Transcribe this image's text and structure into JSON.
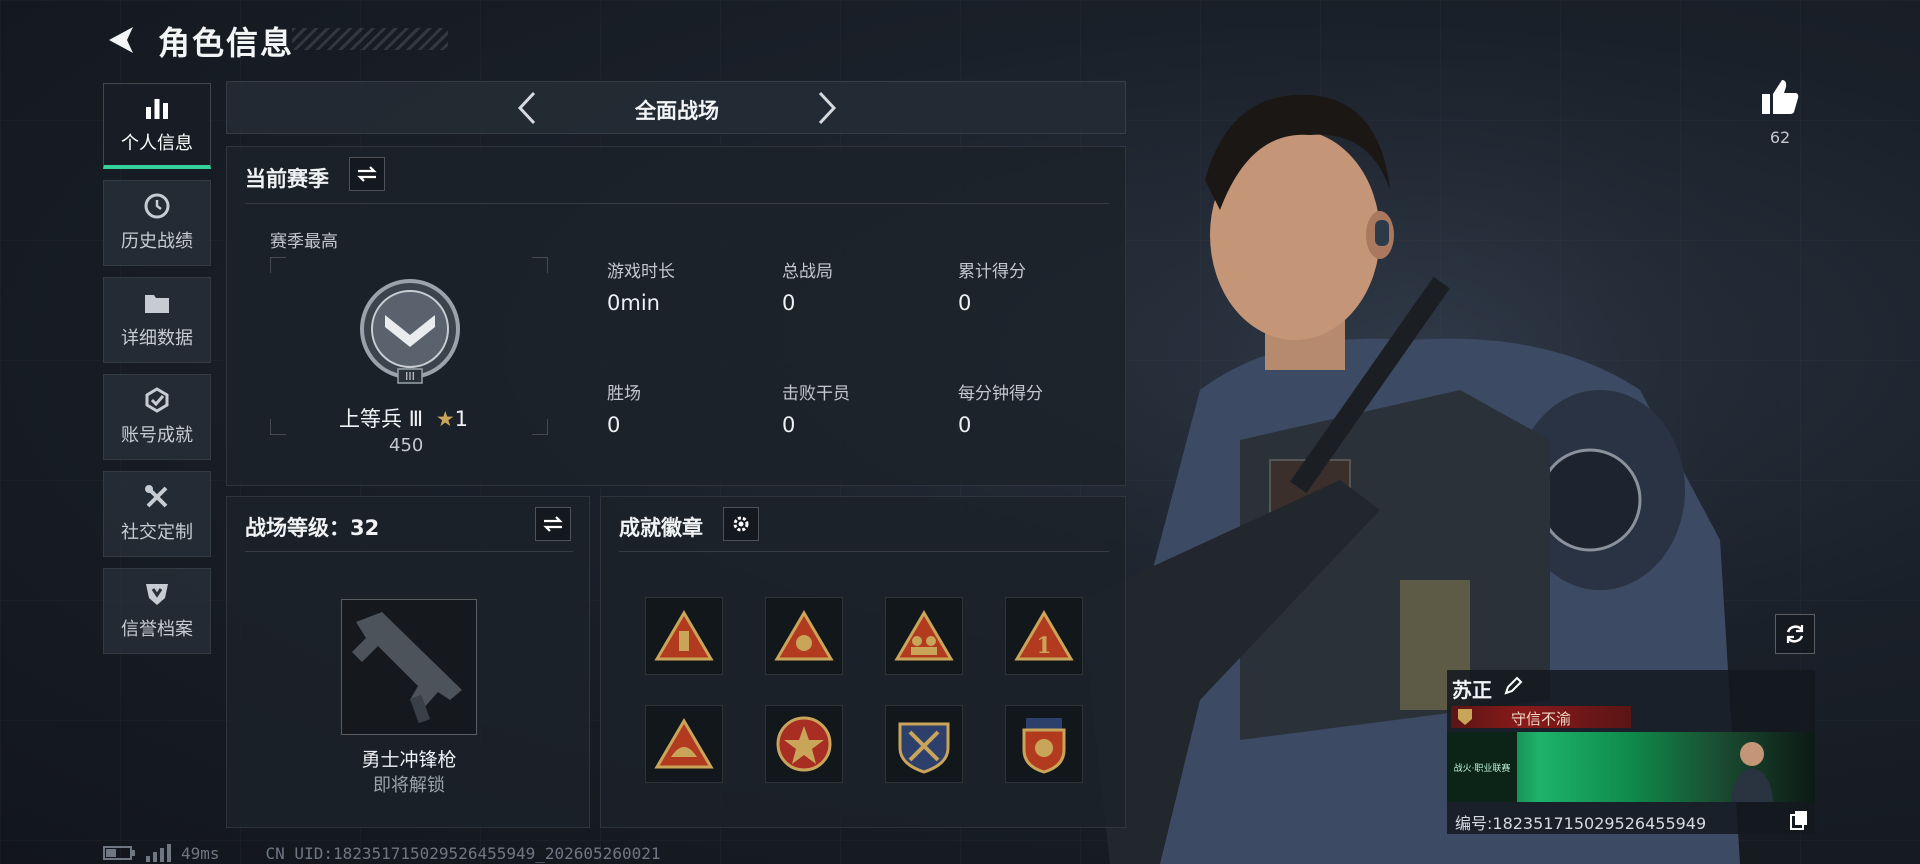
{
  "header": {
    "title": "角色信息"
  },
  "sidebar": {
    "items": [
      {
        "label": "个人信息",
        "icon": "bar-chart-icon",
        "active": true
      },
      {
        "label": "历史战绩",
        "icon": "history-clock-icon"
      },
      {
        "label": "详细数据",
        "icon": "folder-icon"
      },
      {
        "label": "账号成就",
        "icon": "achievement-icon"
      },
      {
        "label": "社交定制",
        "icon": "tools-icon"
      },
      {
        "label": "信誉档案",
        "icon": "shield-icon"
      }
    ]
  },
  "mode": {
    "label": "全面战场"
  },
  "season": {
    "title": "当前赛季",
    "best_label": "赛季最高",
    "rank_name": "上等兵 Ⅲ",
    "rank_stars": "1",
    "rank_points": "450",
    "stats": [
      {
        "label": "游戏时长",
        "value": "0min"
      },
      {
        "label": "总战局",
        "value": "0"
      },
      {
        "label": "累计得分",
        "value": "0"
      },
      {
        "label": "胜场",
        "value": "0"
      },
      {
        "label": "击败干员",
        "value": "0"
      },
      {
        "label": "每分钟得分",
        "value": "0"
      }
    ]
  },
  "battlefield_level": {
    "title": "战场等级：32",
    "weapon_name": "勇士冲锋枪",
    "weapon_status": "即将解锁"
  },
  "badges": {
    "title": "成就徽章",
    "items": [
      "bottle-badge-icon",
      "paw-badge-icon",
      "team-badge-icon",
      "number-one-badge-icon",
      "helmet-badge-icon",
      "star-emblem-badge-icon",
      "crossed-arms-badge-icon",
      "medal-badge-icon"
    ]
  },
  "profile": {
    "likes": "62",
    "name": "苏正",
    "title_tag": "守信不渝",
    "banner_logo": "战火·职业联赛",
    "id_text": "编号:1823517150295264559​49"
  },
  "status_bar": {
    "ping": "49ms",
    "uid": "CN UID:1823517150295264559​49_202605260021"
  },
  "colors": {
    "accent": "#35d39a",
    "gold": "#c9a55a",
    "tag_red": "#8a1a1a"
  }
}
